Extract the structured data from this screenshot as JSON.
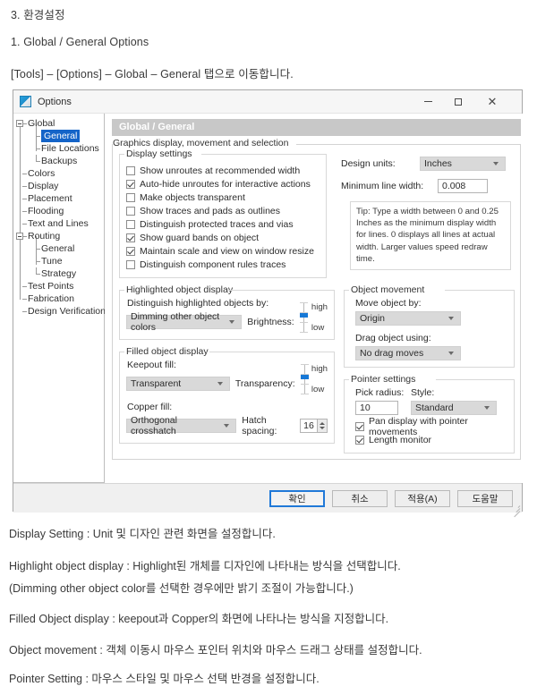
{
  "document": {
    "heading": "3. 환경설정",
    "subheading": "1. Global / General Options",
    "path_line": "[Tools] – [Options] – Global – General 탭으로 이동합니다.",
    "captions": [
      "Display Setting : Unit 및 디자인 관련 화면을 설정합니다.",
      "Highlight object display : Highlight된 개체를 디자인에 나타내는 방식을 선택합니다.",
      "(Dimming other object color를 선택한 경우에만 밝기 조절이 가능합니다.)",
      "Filled Object display : keepout과 Copper의 화면에 나타나는 방식을 지정합니다.",
      "Object movement : 객체 이동시 마우스 포인터 위치와 마우스 드래그 상태를 설정합니다.",
      "Pointer Setting : 마우스 스타일 및 마우스 선택 반경을 설정합니다."
    ]
  },
  "dialog": {
    "title": "Options",
    "icon": "options-app-icon",
    "window_buttons": {
      "minimize": "minimize-icon",
      "maximize": "maximize-icon",
      "close": "✕"
    },
    "tree": [
      {
        "label": "Global",
        "level": 0,
        "expander": true,
        "selected": false
      },
      {
        "label": "General",
        "level": 1,
        "expander": false,
        "selected": true
      },
      {
        "label": "File Locations",
        "level": 1,
        "expander": false,
        "selected": false
      },
      {
        "label": "Backups",
        "level": 1,
        "expander": false,
        "selected": false
      },
      {
        "label": "Colors",
        "level": 0,
        "expander": false,
        "selected": false
      },
      {
        "label": "Display",
        "level": 0,
        "expander": false,
        "selected": false
      },
      {
        "label": "Placement",
        "level": 0,
        "expander": false,
        "selected": false
      },
      {
        "label": "Flooding",
        "level": 0,
        "expander": false,
        "selected": false
      },
      {
        "label": "Text and Lines",
        "level": 0,
        "expander": false,
        "selected": false
      },
      {
        "label": "Routing",
        "level": 0,
        "expander": true,
        "selected": false
      },
      {
        "label": "General",
        "level": 1,
        "expander": false,
        "selected": false
      },
      {
        "label": "Tune",
        "level": 1,
        "expander": false,
        "selected": false
      },
      {
        "label": "Strategy",
        "level": 1,
        "expander": false,
        "selected": false
      },
      {
        "label": "Test Points",
        "level": 0,
        "expander": false,
        "selected": false
      },
      {
        "label": "Fabrication",
        "level": 0,
        "expander": false,
        "selected": false
      },
      {
        "label": "Design Verification",
        "level": 0,
        "expander": false,
        "selected": false
      }
    ],
    "banner": "Global / General",
    "graphics_group": {
      "legend": "Graphics display, movement and selection",
      "display_settings": {
        "legend": "Display settings",
        "checkboxes": [
          {
            "label": "Show unroutes at recommended width",
            "checked": false
          },
          {
            "label": "Auto-hide unroutes for interactive actions",
            "checked": true
          },
          {
            "label": "Make objects transparent",
            "checked": false
          },
          {
            "label": "Show traces and pads as outlines",
            "checked": false
          },
          {
            "label": "Distinguish protected traces and vias",
            "checked": false
          },
          {
            "label": "Show guard bands on object",
            "checked": true
          },
          {
            "label": "Maintain scale and view on window resize",
            "checked": true
          },
          {
            "label": "Distinguish component rules traces",
            "checked": false
          }
        ],
        "design_units_label": "Design units:",
        "design_units_value": "Inches",
        "min_line_width_label": "Minimum line width:",
        "min_line_width_value": "0.008",
        "tip": "Tip: Type a width between 0 and 0.25 Inches as the minimum display width for lines. 0 displays all lines at actual width. Larger values speed redraw time."
      },
      "highlighted_object_display": {
        "legend": "Highlighted object display",
        "distinguish_label": "Distinguish highlighted objects by:",
        "distinguish_value": "Dimming other object colors",
        "brightness_label": "Brightness:",
        "slider_high": "high",
        "slider_low": "low"
      },
      "filled_object_display": {
        "legend": "Filled object display",
        "keepout_fill_label": "Keepout fill:",
        "keepout_fill_value": "Transparent",
        "transparency_label": "Transparency:",
        "slider_high": "high",
        "slider_low": "low",
        "copper_fill_label": "Copper fill:",
        "copper_fill_value": "Orthogonal crosshatch",
        "hatch_spacing_label": "Hatch spacing:",
        "hatch_spacing_value": "16"
      },
      "object_movement": {
        "legend": "Object movement",
        "move_object_by_label": "Move object by:",
        "move_object_by_value": "Origin",
        "drag_object_using_label": "Drag object using:",
        "drag_object_using_value": "No drag moves"
      },
      "pointer_settings": {
        "legend": "Pointer settings",
        "pick_radius_label": "Pick radius:",
        "pick_radius_value": "10",
        "style_label": "Style:",
        "style_value": "Standard",
        "checkboxes": [
          {
            "label": "Pan display with pointer movements",
            "checked": true
          },
          {
            "label": "Length monitor",
            "checked": true
          }
        ]
      }
    },
    "footer_buttons": [
      {
        "label": "확인",
        "default": true
      },
      {
        "label": "취소",
        "default": false
      },
      {
        "label": "적용(A)",
        "default": false
      },
      {
        "label": "도움말",
        "default": false
      }
    ]
  },
  "colors": {
    "accent": "#1464c8",
    "banner": "#c8c8c8",
    "slider_thumb": "#1778d6",
    "default_button_border": "#2079d8"
  }
}
